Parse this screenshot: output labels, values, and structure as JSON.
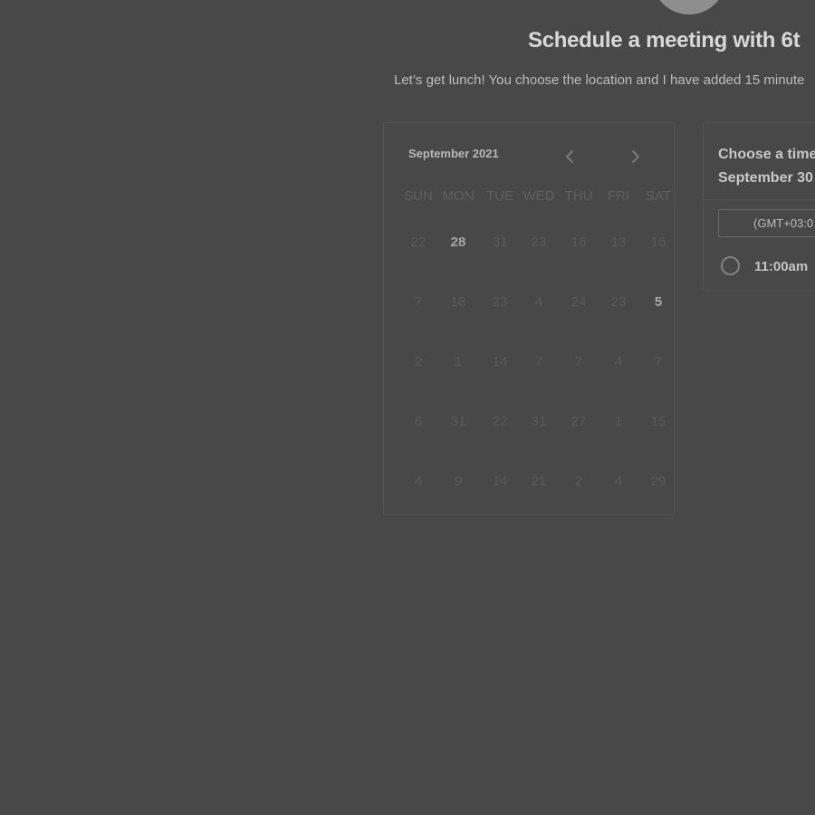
{
  "page": {
    "title": "Schedule a meeting with 6t",
    "description": "Let’s get lunch! You choose the location and I have added 15 minute"
  },
  "calendar": {
    "month_label": "September 2021",
    "prev_icon": "chevron-left-icon",
    "next_icon": "chevron-right-icon",
    "weekdays": [
      "SUN",
      "MON",
      "TUE",
      "WED",
      "THU",
      "FRI",
      "SAT"
    ],
    "weeks": [
      [
        "22",
        "28",
        "31",
        "23",
        "16",
        "13",
        "16"
      ],
      [
        "7",
        "18",
        "23",
        "4",
        "24",
        "23",
        "5"
      ],
      [
        "2",
        "1",
        "14",
        "7",
        "7",
        "4",
        "7"
      ],
      [
        "6",
        "31",
        "22",
        "31",
        "27",
        "1",
        "15"
      ],
      [
        "4",
        "9",
        "14",
        "21",
        "2",
        "4",
        "29"
      ]
    ],
    "available": [
      [
        0,
        1
      ],
      [
        1,
        6
      ]
    ]
  },
  "time_panel": {
    "heading_line1": "Choose a time",
    "heading_line2": "September 30",
    "timezone": "(GMT+03:0",
    "slots": [
      "11:00am"
    ],
    "radio_icon": "radio-unselected-icon"
  },
  "colors": {
    "background": "#484848",
    "card_border": "#555555",
    "muted_day": "#5a5a5a",
    "available_day": "#a8a8a8"
  }
}
